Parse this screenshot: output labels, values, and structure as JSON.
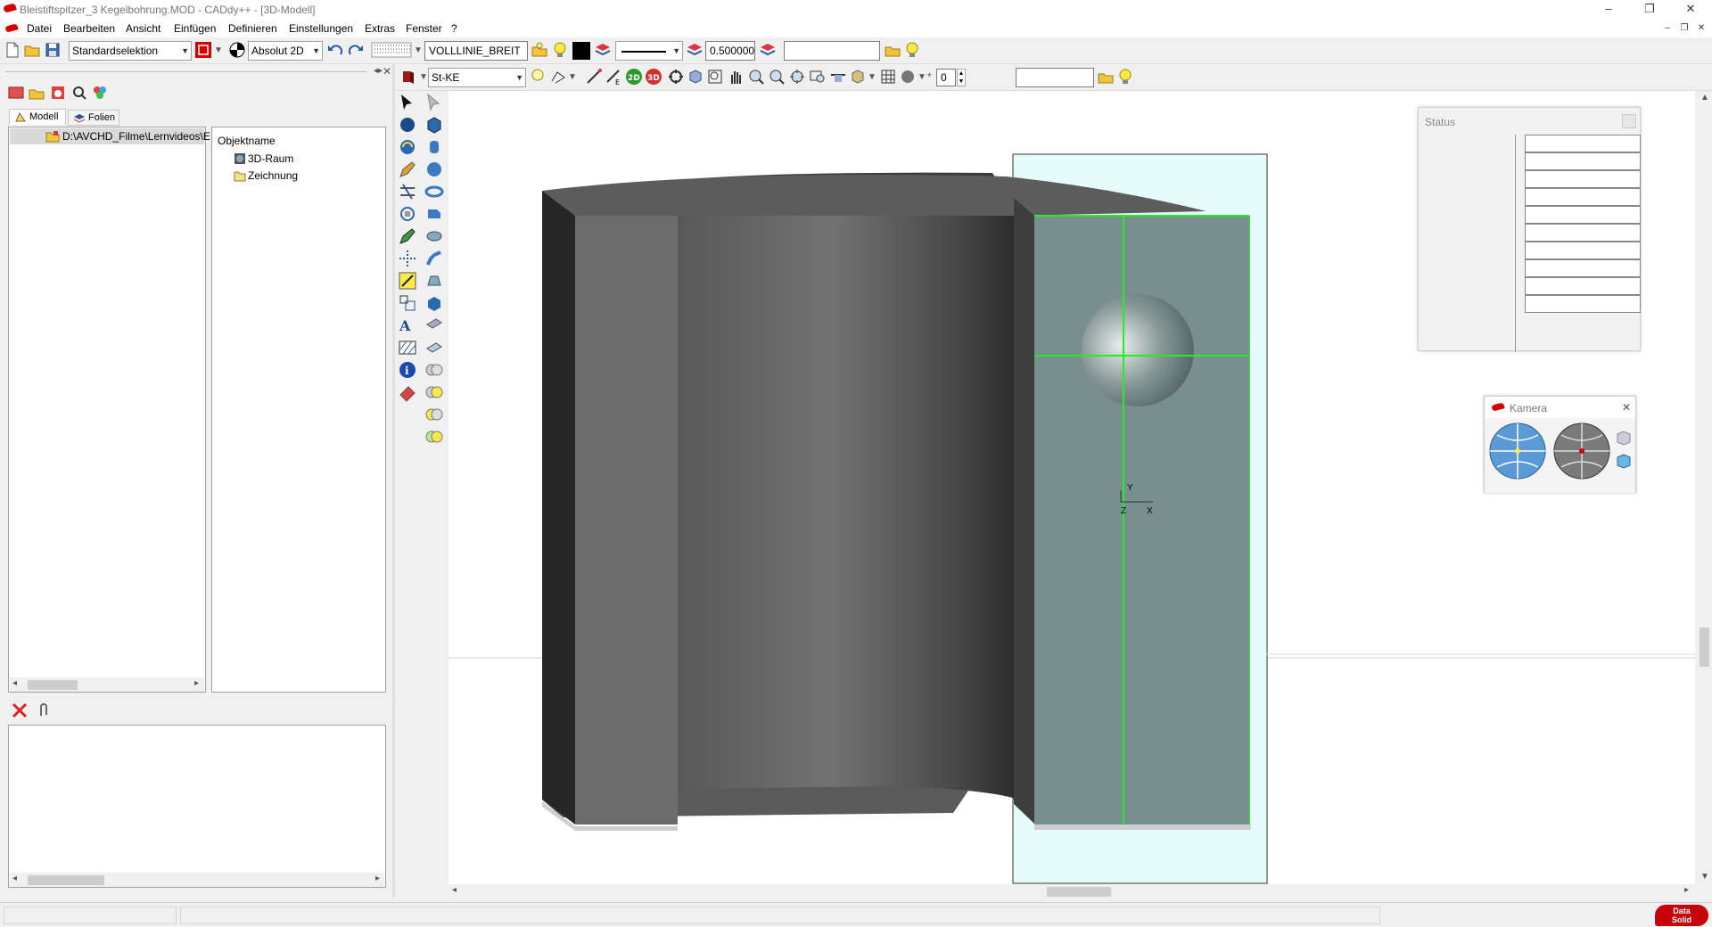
{
  "window": {
    "title": "Bleistiftspitzer_3 Kegelbohrung.MOD  -  CADdy++ - [3D-Modell]",
    "controls": {
      "minimize": "–",
      "restore": "❐",
      "close": "✕"
    }
  },
  "menubar": {
    "items": [
      "Datei",
      "Bearbeiten",
      "Ansicht",
      "Einfügen",
      "Definieren",
      "Einstellungen",
      "Extras",
      "Fenster",
      "?"
    ],
    "mdi": {
      "minimize": "–",
      "restore": "❐",
      "close": "✕"
    }
  },
  "toolbar1": {
    "selection_mode": "Standardselektion",
    "coord_mode": "Absolut 2D",
    "linetype_name": "VOLLLINIE_BREIT",
    "line_width": "0.500000",
    "layer_field": ""
  },
  "toolbar2": {
    "material": "St-KE",
    "count_value": "0",
    "extra_field": ""
  },
  "left_panel": {
    "tabs": [
      "Modell",
      "Folien"
    ],
    "tree_root": "D:\\AVCHD_Filme\\Lernvideos\\E",
    "object_header": "Objektname",
    "objects": [
      "3D-Raum",
      "Zeichnung"
    ]
  },
  "status_panel": {
    "title": "Status"
  },
  "camera_panel": {
    "title": "Kamera"
  },
  "viewport": {
    "axis_y": "Y",
    "axis_x": "X",
    "axis_z": "Z"
  },
  "brand": {
    "line1": "Data",
    "line2": "Solid"
  },
  "colors": {
    "accent_red": "#d40000",
    "selection_green": "#22ee22",
    "model_gray": "#6b6b6b",
    "select_cyan": "#e6fcfc"
  },
  "icons": {
    "view_tools": [
      "select-arrow-icon",
      "sphere-icon",
      "rotate-icon",
      "pencil-icon",
      "trim-icon",
      "transform-icon",
      "edit-line-icon",
      "snap-icon",
      "dimension-icon",
      "scale-icon",
      "text-icon",
      "hatch-icon",
      "info-icon",
      "eraser-icon"
    ],
    "solid_tools": [
      "pointer-gray-icon",
      "box-icon",
      "cylinder-icon",
      "sphere-solid-icon",
      "torus-icon",
      "extrude-icon",
      "revolve-icon",
      "sweep-icon",
      "loft-icon",
      "chamfer-icon",
      "shell-icon",
      "slice-icon",
      "boolean-union-icon",
      "boolean-subtract-icon",
      "boolean-intersect-icon",
      "boolean-misc-icon"
    ]
  }
}
